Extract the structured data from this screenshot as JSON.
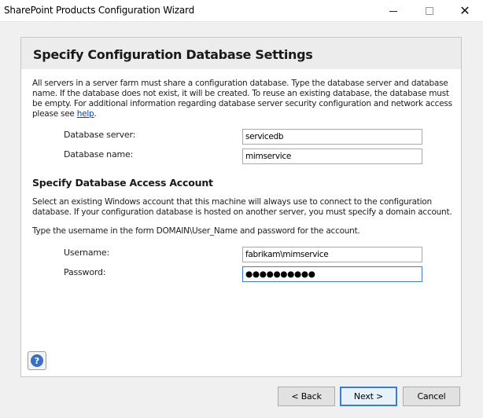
{
  "window": {
    "title": "SharePoint Products Configuration Wizard",
    "minimize_icon": "minimize-icon",
    "maximize_icon": "maximize-icon",
    "close_icon": "close-icon",
    "close_glyph": "✕"
  },
  "page": {
    "heading": "Specify Configuration Database Settings",
    "intro_text": "All servers in a server farm must share a configuration database. Type the database server and database name. If the database does not exist, it will be created. To reuse an existing database, the database must be empty. For additional information regarding database server security configuration and network access please see ",
    "help_link": "help",
    "intro_end": ".",
    "database_server_label": "Database server:",
    "database_server_value": "servicedb",
    "database_name_label": "Database name:",
    "database_name_value": "mimservice",
    "access_heading": "Specify Database Access Account",
    "access_text": "Select an existing Windows account that this machine will always use to connect to the configuration database. If your configuration database is hosted on another server, you must specify a domain account.",
    "username_hint": "Type the username in the form DOMAIN\\User_Name and password for the account.",
    "username_label": "Username:",
    "username_value": "fabrikam\\mimservice",
    "password_label": "Password:",
    "password_value": "●●●●●●●●●●"
  },
  "help_button": {
    "glyph": "?",
    "icon": "help-icon"
  },
  "buttons": {
    "back": "< Back",
    "next": "Next  >",
    "cancel": "Cancel"
  },
  "colors": {
    "accent": "#3d7bd1",
    "link": "#0645ad",
    "help_icon": "#3c6fc2"
  }
}
